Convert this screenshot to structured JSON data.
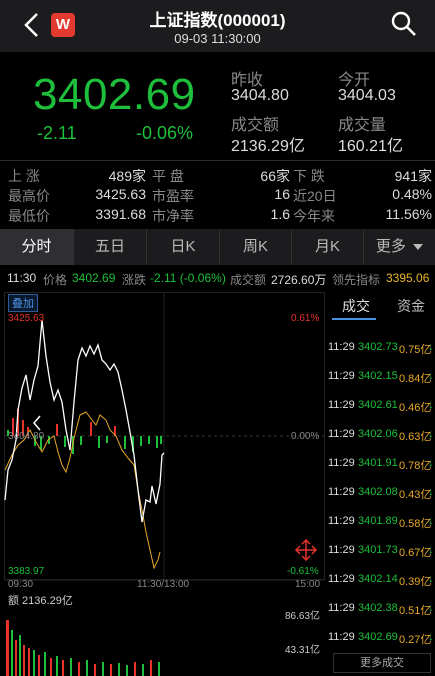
{
  "header": {
    "title": "上证指数(000001)",
    "subtitle": "09-03 11:30:00",
    "logo_text": "W",
    "colors": {
      "up": "#e8332a",
      "down": "#1ec03b",
      "accent": "#4a90e2"
    }
  },
  "quote": {
    "price": "3402.69",
    "change": "-2.11",
    "change_pct": "-0.06%",
    "stats": [
      {
        "label": "昨收",
        "value": "3404.80"
      },
      {
        "label": "今开",
        "value": "3404.03"
      },
      {
        "label": "成交额",
        "value": "2136.29亿"
      },
      {
        "label": "成交量",
        "value": "160.21亿"
      }
    ]
  },
  "breadth": [
    [
      {
        "label": "上 涨",
        "value": "489家"
      },
      {
        "label": "平 盘",
        "value": "66家"
      },
      {
        "label": "下 跌",
        "value": "941家"
      }
    ],
    [
      {
        "label": "最高价",
        "value": "3425.63"
      },
      {
        "label": "市盈率",
        "value": "16"
      },
      {
        "label": "近20日",
        "value": "0.48%"
      }
    ],
    [
      {
        "label": "最低价",
        "value": "3391.68"
      },
      {
        "label": "市净率",
        "value": "1.6"
      },
      {
        "label": "今年来",
        "value": "11.56%"
      }
    ]
  ],
  "tabs": [
    "分时",
    "五日",
    "日K",
    "周K",
    "月K",
    "更多"
  ],
  "infobar": {
    "time": "11:30",
    "price_label": "价格",
    "price": "3402.69",
    "chg_label": "涨跌",
    "chg": "-2.11 (-0.06%)",
    "amount_label": "成交额",
    "amount": "2726.60万",
    "lead_label": "领先指标",
    "lead": "3395.06"
  },
  "chart": {
    "badge": "叠加",
    "y_high": "3425.63",
    "y_mid": "3404.80",
    "y_low": "3383.97",
    "pct_high": "0.61%",
    "pct_mid": "0.00%",
    "pct_low": "-0.61%",
    "x_start": "09:30",
    "x_mid": "11:30/13:00",
    "x_end": "15:00",
    "vol_label": "额 2136.29亿",
    "vol_high": "86.63亿",
    "vol_mid": "43.31亿"
  },
  "side": {
    "tab_trades": "成交",
    "tab_funds": "资金",
    "trades": [
      {
        "time": "11:29",
        "price": "3402.73",
        "amount": "0.75亿",
        "dir": "down"
      },
      {
        "time": "11:29",
        "price": "3402.15",
        "amount": "0.84亿",
        "dir": "down"
      },
      {
        "time": "11:29",
        "price": "3402.61",
        "amount": "0.46亿",
        "dir": "down"
      },
      {
        "time": "11:29",
        "price": "3402.06",
        "amount": "0.63亿",
        "dir": "down"
      },
      {
        "time": "11:29",
        "price": "3401.91",
        "amount": "0.78亿",
        "dir": "down"
      },
      {
        "time": "11:29",
        "price": "3402.08",
        "amount": "0.43亿",
        "dir": "down"
      },
      {
        "time": "11:29",
        "price": "3401.89",
        "amount": "0.58亿",
        "dir": "down"
      },
      {
        "time": "11:29",
        "price": "3401.73",
        "amount": "0.67亿",
        "dir": "down"
      },
      {
        "time": "11:29",
        "price": "3402.14",
        "amount": "0.39亿",
        "dir": "down"
      },
      {
        "time": "11:29",
        "price": "3402.38",
        "amount": "0.51亿",
        "dir": "down"
      },
      {
        "time": "11:29",
        "price": "3402.69",
        "amount": "0.27亿",
        "dir": "down"
      }
    ],
    "more": "更多成交"
  }
}
